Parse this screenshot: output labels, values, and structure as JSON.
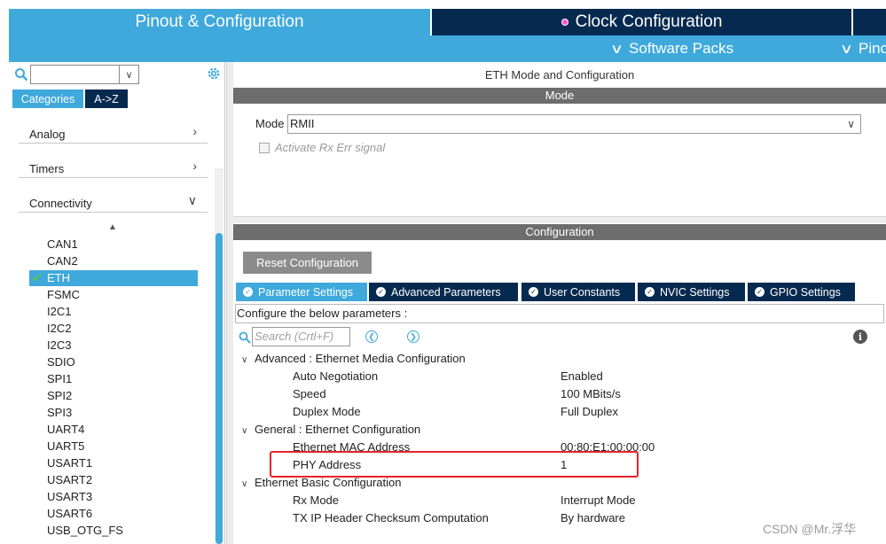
{
  "header": {
    "tab_pinout": "Pinout & Configuration",
    "tab_clock": "Clock Configuration",
    "software_packs": "Software Packs",
    "pinout_menu": "Pino"
  },
  "left": {
    "search_placeholder": "",
    "tab_categories": "Categories",
    "tab_az": "A->Z",
    "categories": [
      {
        "label": "Analog",
        "state": "collapsed"
      },
      {
        "label": "Timers",
        "state": "collapsed"
      },
      {
        "label": "Connectivity",
        "state": "expanded"
      }
    ],
    "items": [
      "CAN1",
      "CAN2",
      "ETH",
      "FSMC",
      "I2C1",
      "I2C2",
      "I2C3",
      "SDIO",
      "SPI1",
      "SPI2",
      "SPI3",
      "UART4",
      "UART5",
      "USART1",
      "USART2",
      "USART3",
      "USART6",
      "USB_OTG_FS"
    ],
    "selected_item": "ETH"
  },
  "right": {
    "panel_title": "ETH Mode and Configuration",
    "mode_band": "Mode",
    "mode_label": "Mode",
    "mode_value": "RMII",
    "rx_err_label": "Activate Rx Err signal",
    "rx_err_checked": false,
    "config_band": "Configuration",
    "reset_button": "Reset Configuration",
    "tabs": [
      "Parameter Settings",
      "Advanced Parameters",
      "User Constants",
      "NVIC Settings",
      "GPIO Settings"
    ],
    "active_tab": "Parameter Settings",
    "hint": "Configure the below parameters :",
    "search_placeholder": "Search (Crtl+F)",
    "groups": [
      {
        "title": "Advanced : Ethernet Media Configuration",
        "params": [
          {
            "name": "Auto Negotiation",
            "value": "Enabled"
          },
          {
            "name": "Speed",
            "value": "100 MBits/s"
          },
          {
            "name": "Duplex Mode",
            "value": "Full Duplex"
          }
        ]
      },
      {
        "title": "General : Ethernet Configuration",
        "params": [
          {
            "name": "Ethernet MAC Address",
            "value": "00:80:E1:00:00:00"
          },
          {
            "name": "PHY Address",
            "value": "1"
          }
        ]
      },
      {
        "title": "Ethernet Basic Configuration",
        "params": [
          {
            "name": "Rx Mode",
            "value": "Interrupt Mode"
          },
          {
            "name": "TX IP Header Checksum Computation",
            "value": "By hardware"
          }
        ]
      }
    ]
  },
  "watermark": "CSDN @Mr.浮华",
  "colors": {
    "accent_blue": "#3fa9dc",
    "navy": "#06294f",
    "band_gray": "#6d6d6d",
    "highlight_red": "#e6232b",
    "check_green": "#5ec92c"
  }
}
